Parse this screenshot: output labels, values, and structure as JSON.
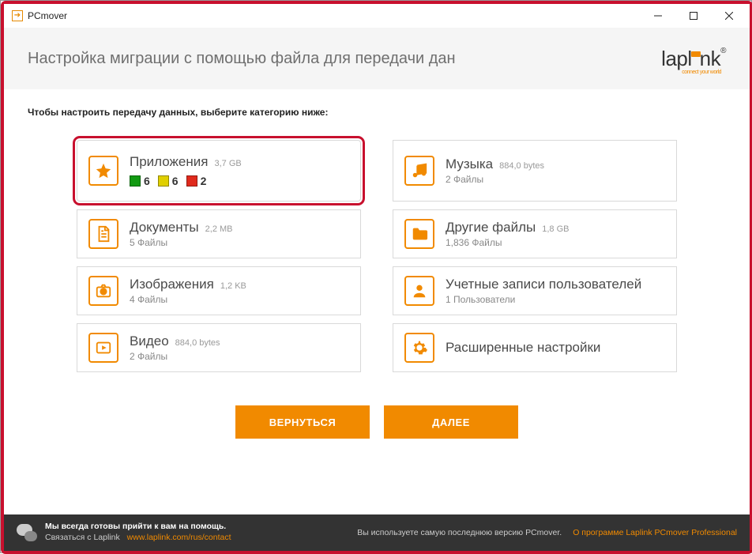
{
  "titlebar": {
    "app_name": "PCmover"
  },
  "header": {
    "title": "Настройка миграции с помощью файла для передачи дан"
  },
  "logo": {
    "text_before": "lapl",
    "text_after": "nk",
    "reg": "®",
    "tagline": "connect your world"
  },
  "instruction": "Чтобы настроить передачу данных, выберите категорию ниже:",
  "cards": {
    "apps": {
      "title": "Приложения",
      "size": "3,7 GB",
      "badges": {
        "green": "6",
        "yellow": "6",
        "red": "2"
      }
    },
    "music": {
      "title": "Музыка",
      "size": "884,0 bytes",
      "sub": "2 Файлы"
    },
    "docs": {
      "title": "Документы",
      "size": "2,2 MB",
      "sub": "5 Файлы"
    },
    "other": {
      "title": "Другие файлы",
      "size": "1,8 GB",
      "sub": "1,836 Файлы"
    },
    "images": {
      "title": "Изображения",
      "size": "1,2 KB",
      "sub": "4 Файлы"
    },
    "users": {
      "title": "Учетные записи пользователей",
      "sub": "1 Пользователи"
    },
    "video": {
      "title": "Видео",
      "size": "884,0 bytes",
      "sub": "2 Файлы"
    },
    "advanced": {
      "title": "Расширенные настройки"
    }
  },
  "buttons": {
    "back": "ВЕРНУТЬСЯ",
    "next": "ДАЛЕЕ"
  },
  "footer": {
    "help_title": "Мы всегда готовы прийти к вам на помощь.",
    "contact_label": "Связаться с Laplink",
    "contact_url": "www.laplink.com/rus/contact",
    "version": "Вы используете самую последнюю версию PCmover.",
    "about": "О программе Laplink PCmover Professional"
  }
}
